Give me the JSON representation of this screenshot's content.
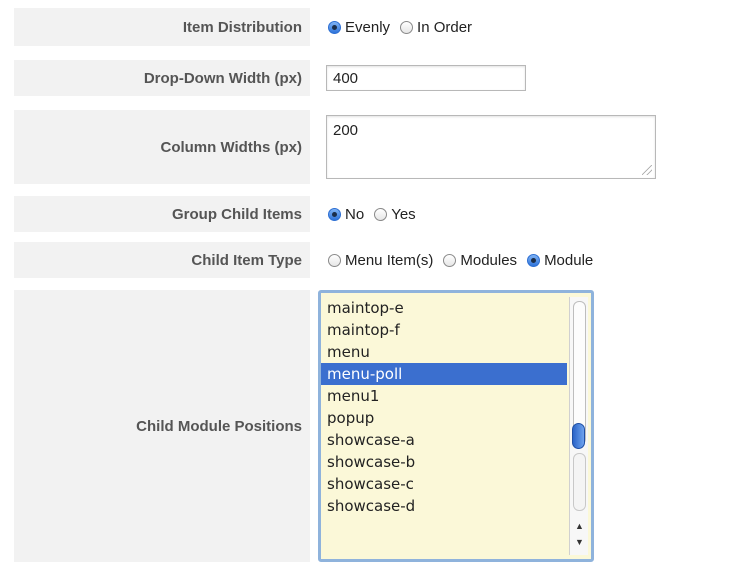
{
  "item_distribution": {
    "label": "Item Distribution",
    "options": [
      {
        "label": "Evenly",
        "checked": true
      },
      {
        "label": "In Order",
        "checked": false
      }
    ]
  },
  "dropdown_width": {
    "label": "Drop-Down Width (px)",
    "value": "400"
  },
  "column_widths": {
    "label": "Column Widths (px)",
    "value": "200"
  },
  "group_child_items": {
    "label": "Group Child Items",
    "options": [
      {
        "label": "No",
        "checked": true
      },
      {
        "label": "Yes",
        "checked": false
      }
    ]
  },
  "child_item_type": {
    "label": "Child Item Type",
    "options": [
      {
        "label": "Menu Item(s)",
        "checked": false
      },
      {
        "label": "Modules",
        "checked": false
      },
      {
        "label": "Module",
        "checked": true
      }
    ]
  },
  "child_module_positions": {
    "label": "Child Module Positions",
    "items": [
      "maintop-e",
      "maintop-f",
      "menu",
      "menu-poll",
      "menu1",
      "popup",
      "showcase-a",
      "showcase-b",
      "showcase-c",
      "showcase-d"
    ],
    "selected": "menu-poll"
  },
  "colors": {
    "selection": "#3b6fcf",
    "listbox_bg": "#fbf8d8",
    "label_bg": "#f2f2f2"
  }
}
